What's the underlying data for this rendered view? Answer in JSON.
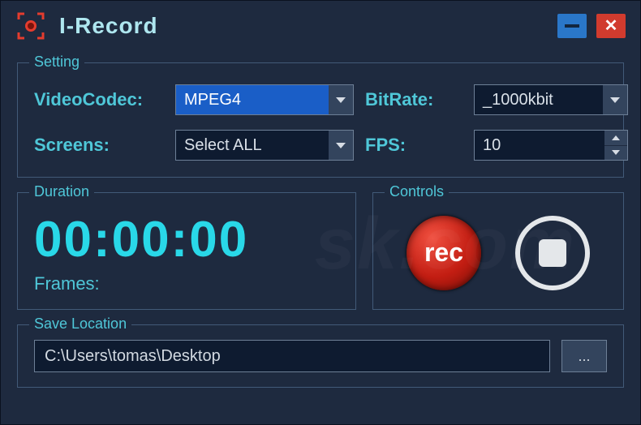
{
  "app": {
    "title": "I-Record"
  },
  "titlebar": {
    "min_tip": "Minimize",
    "close_tip": "Close"
  },
  "setting": {
    "legend": "Setting",
    "videocodec_label": "VideoCodec:",
    "videocodec_value": "MPEG4",
    "bitrate_label": "BitRate:",
    "bitrate_value": "_1000kbit",
    "screens_label": "Screens:",
    "screens_value": "Select ALL",
    "fps_label": "FPS:",
    "fps_value": "10"
  },
  "duration": {
    "legend": "Duration",
    "time": "00:00:00",
    "frames_label": "Frames:",
    "frames_value": ""
  },
  "controls": {
    "legend": "Controls",
    "record_label": "rec"
  },
  "save": {
    "legend": "Save Location",
    "path": "C:\\Users\\tomas\\Desktop",
    "browse_label": "..."
  }
}
